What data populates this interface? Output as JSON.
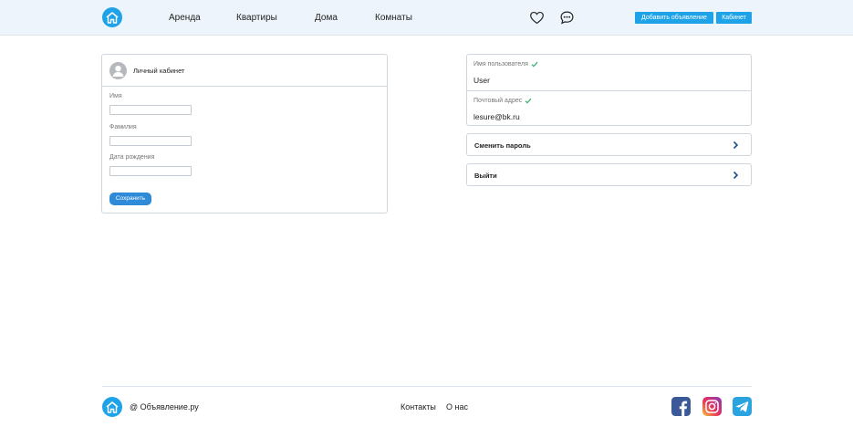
{
  "header": {
    "nav": [
      "Аренда",
      "Квартиры",
      "Дома",
      "Комнаты"
    ],
    "add_listing_label": "Добавить объявление",
    "cabinet_label": "Кабинет"
  },
  "profile_form": {
    "title": "Личный кабинет",
    "first_name_label": "Имя",
    "first_name_value": "",
    "last_name_label": "Фамилия",
    "last_name_value": "",
    "birth_date_label": "Дата рождения",
    "birth_date_value": "",
    "save_label": "Сохранить"
  },
  "account": {
    "username_label": "Имя пользователя",
    "username_value": "User",
    "email_label": "Почтовый адрес",
    "email_value": "lesure@bk.ru",
    "change_password_label": "Сменить пароль",
    "logout_label": "Выйти"
  },
  "footer": {
    "brand": "@ Объявление.ру",
    "links": [
      "Контакты",
      "О нас"
    ]
  },
  "colors": {
    "accent": "#1fa3e8",
    "save_button": "#2f8bd8",
    "header_bg": "#eef4fb",
    "facebook": "#3b5998",
    "telegram": "#2aa3e0"
  },
  "icons": [
    "home-icon",
    "heart-icon",
    "chat-icon",
    "user-icon",
    "check-icon",
    "chevron-right-icon",
    "facebook-icon",
    "instagram-icon",
    "telegram-icon"
  ]
}
